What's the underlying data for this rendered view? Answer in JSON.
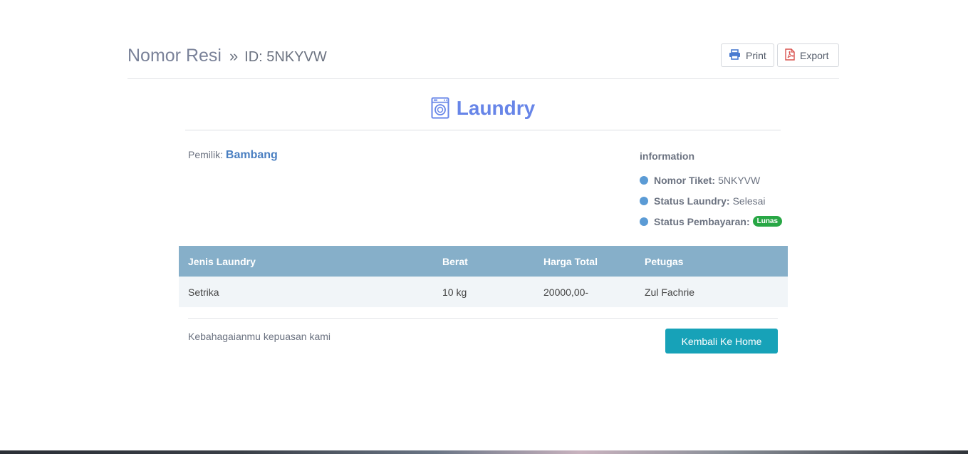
{
  "header": {
    "title": "Nomor Resi",
    "separator": "»",
    "id_text": "ID: 5NKYVW",
    "print_label": "Print",
    "export_label": "Export"
  },
  "brand": {
    "name": "Laundry",
    "icon": "washing-machine-icon",
    "color": "#6785e8"
  },
  "owner": {
    "label": "Pemilik:",
    "name": "Bambang"
  },
  "information": {
    "heading": "information",
    "rows": [
      {
        "label": "Nomor Tiket:",
        "value": "5NKYVW"
      },
      {
        "label": "Status Laundry:",
        "value": "Selesai"
      },
      {
        "label": "Status Pembayaran:",
        "value": "Lunas"
      }
    ]
  },
  "table": {
    "headers": [
      "Jenis Laundry",
      "Berat",
      "Harga Total",
      "Petugas"
    ],
    "rows": [
      [
        "Setrika",
        "10 kg",
        "20000,00-",
        "Zul Fachrie"
      ]
    ]
  },
  "footer": {
    "note": "Kebahagaianmu kepuasan kami",
    "home_button": "Kembali Ke Home"
  },
  "colors": {
    "table_header": "#86afc9",
    "badge_success": "#28a745",
    "home_button": "#17a2b8",
    "dot": "#5b9bd5"
  }
}
